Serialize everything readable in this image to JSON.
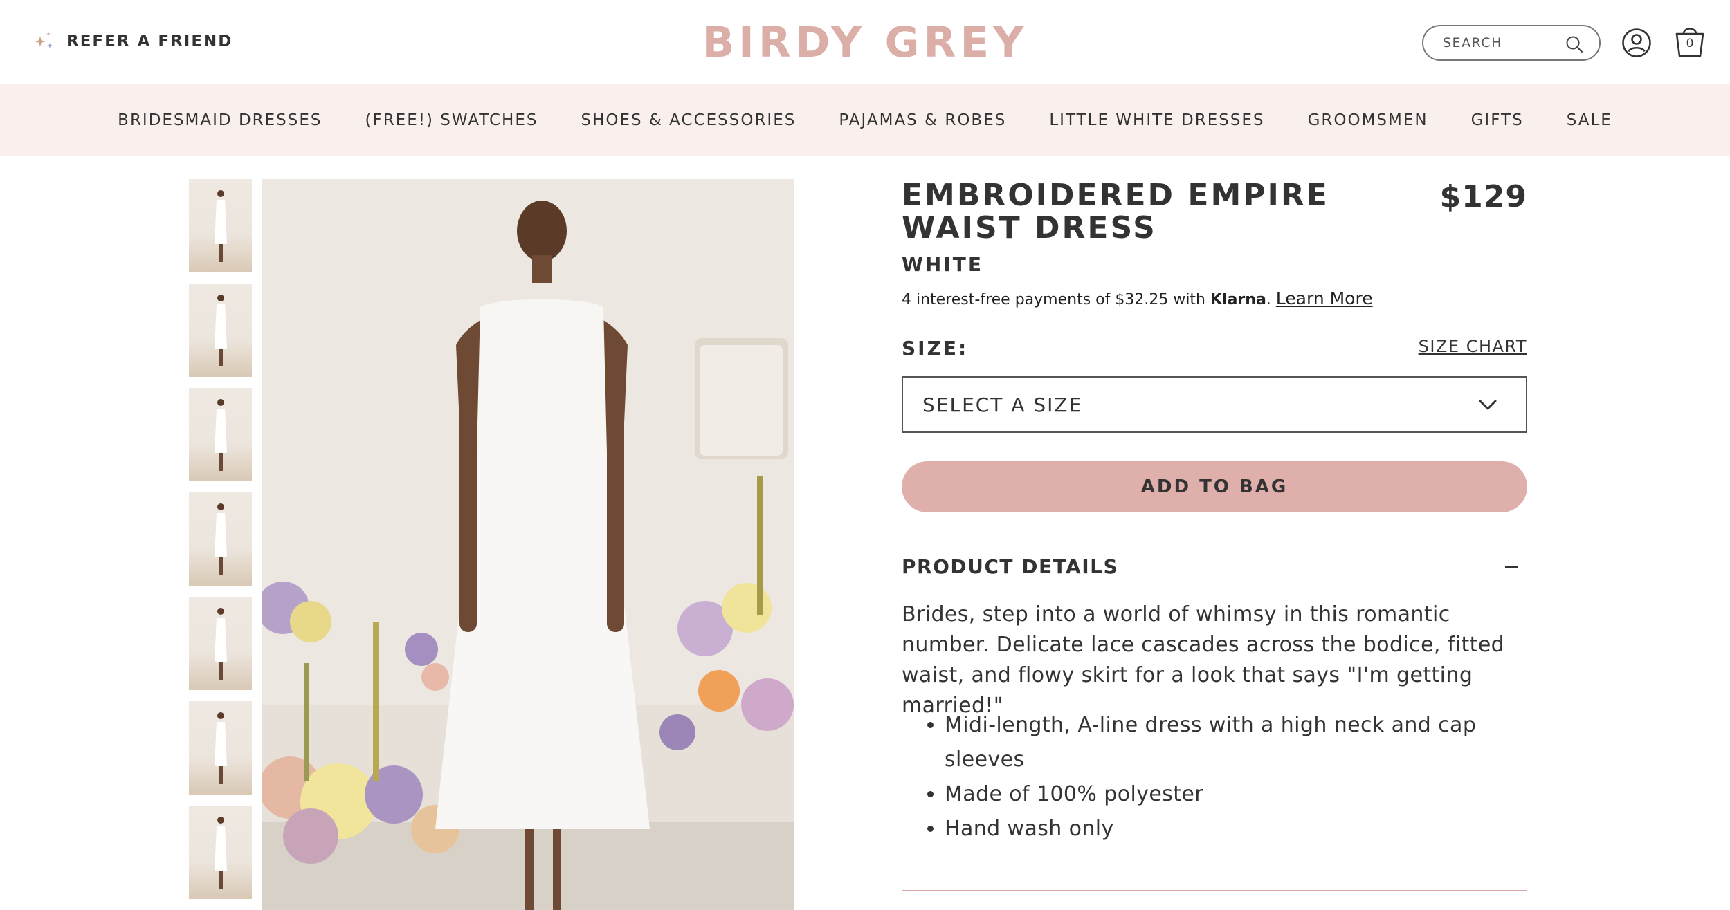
{
  "header": {
    "refer_label": "REFER A FRIEND",
    "logo": "BIRDY GREY",
    "search_placeholder": "SEARCH",
    "bag_count": "0"
  },
  "nav": {
    "items": [
      {
        "label": "BRIDESMAID DRESSES"
      },
      {
        "label": "(FREE!) SWATCHES"
      },
      {
        "label": "SHOES & ACCESSORIES"
      },
      {
        "label": "PAJAMAS & ROBES"
      },
      {
        "label": "LITTLE WHITE DRESSES"
      },
      {
        "label": "GROOMSMEN"
      },
      {
        "label": "GIFTS"
      },
      {
        "label": "SALE"
      }
    ]
  },
  "product": {
    "title": "EMBROIDERED EMPIRE WAIST DRESS",
    "price": "$129",
    "color": "WHITE",
    "klarna_text": "4 interest-free payments of $32.25 with ",
    "klarna_brand": "Klarna",
    "klarna_period": ".",
    "learn_more": "Learn More",
    "size_label": "SIZE:",
    "size_chart": "SIZE CHART",
    "size_select": "SELECT A SIZE",
    "add_to_bag": "ADD TO BAG",
    "details_heading": "PRODUCT DETAILS",
    "description": "Brides, step into a world of whimsy in this romantic number. Delicate lace cascades across the bodice, fitted waist, and flowy skirt for a look that says \"I'm getting married!\"",
    "bullets": [
      "Midi-length, A-line dress with a high neck and cap sleeves",
      "Made of 100% polyester",
      "Hand wash only"
    ]
  },
  "colors": {
    "logo": "#dcaea8",
    "nav_bg": "#f9f0ed",
    "add_to_bag_bg": "#dfb0ab",
    "divider": "#d9a7a1"
  },
  "icons": [
    "sparkle-icon",
    "search-icon",
    "account-icon",
    "shopping-bag-icon",
    "chevron-down-icon",
    "minus-icon"
  ]
}
